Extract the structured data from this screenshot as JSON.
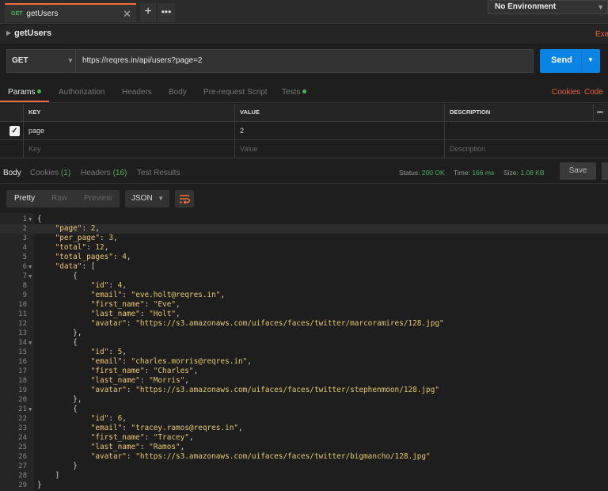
{
  "tab": {
    "method": "GET",
    "name": "getUsers",
    "close": "✕",
    "add": "+",
    "more": "•••"
  },
  "environment": {
    "selected": "No Environment"
  },
  "request": {
    "title": "getUsers",
    "examples_link": "Exa",
    "method": "GET",
    "url": "https://reqres.in/api/users?page=2",
    "send_label": "Send"
  },
  "request_tabs": {
    "params": "Params",
    "authorization": "Authorization",
    "headers": "Headers",
    "body": "Body",
    "prerequest": "Pre-request Script",
    "tests": "Tests",
    "cookies": "Cookies",
    "code": "Code"
  },
  "params_table": {
    "headers": [
      "KEY",
      "VALUE",
      "DESCRIPTION"
    ],
    "more": "•••",
    "rows": [
      {
        "key": "page",
        "value": "2",
        "checked": true
      }
    ],
    "placeholders": {
      "key": "Key",
      "value": "Value",
      "description": "Description"
    }
  },
  "response_tabs": {
    "body": "Body",
    "cookies": "Cookies",
    "cookies_count": "(1)",
    "headers": "Headers",
    "headers_count": "(16)",
    "tests": "Test Results"
  },
  "response_status": {
    "status_label": "Status:",
    "status_value": "200 OK",
    "time_label": "Time:",
    "time_value": "166 ms",
    "size_label": "Size:",
    "size_value": "1.08 KB",
    "save_label": "Save"
  },
  "view_modes": {
    "pretty": "Pretty",
    "raw": "Raw",
    "preview": "Preview",
    "format": "JSON"
  },
  "code_lines": [
    {
      "n": "1",
      "fold": true,
      "t": "{"
    },
    {
      "n": "2",
      "t": "    \"page\": 2,"
    },
    {
      "n": "3",
      "t": "    \"per_page\": 3,"
    },
    {
      "n": "4",
      "t": "    \"total\": 12,"
    },
    {
      "n": "5",
      "t": "    \"total_pages\": 4,"
    },
    {
      "n": "6",
      "fold": true,
      "t": "    \"data\": ["
    },
    {
      "n": "7",
      "fold": true,
      "t": "        {"
    },
    {
      "n": "8",
      "t": "            \"id\": 4,"
    },
    {
      "n": "9",
      "t": "            \"email\": \"eve.holt@reqres.in\","
    },
    {
      "n": "10",
      "t": "            \"first_name\": \"Eve\","
    },
    {
      "n": "11",
      "t": "            \"last_name\": \"Holt\","
    },
    {
      "n": "12",
      "t": "            \"avatar\": \"https://s3.amazonaws.com/uifaces/faces/twitter/marcoramires/128.jpg\""
    },
    {
      "n": "13",
      "t": "        },"
    },
    {
      "n": "14",
      "fold": true,
      "t": "        {"
    },
    {
      "n": "15",
      "t": "            \"id\": 5,"
    },
    {
      "n": "16",
      "t": "            \"email\": \"charles.morris@reqres.in\","
    },
    {
      "n": "17",
      "t": "            \"first_name\": \"Charles\","
    },
    {
      "n": "18",
      "t": "            \"last_name\": \"Morris\","
    },
    {
      "n": "19",
      "t": "            \"avatar\": \"https://s3.amazonaws.com/uifaces/faces/twitter/stephenmoon/128.jpg\""
    },
    {
      "n": "20",
      "t": "        },"
    },
    {
      "n": "21",
      "fold": true,
      "t": "        {"
    },
    {
      "n": "22",
      "t": "            \"id\": 6,"
    },
    {
      "n": "23",
      "t": "            \"email\": \"tracey.ramos@reqres.in\","
    },
    {
      "n": "24",
      "t": "            \"first_name\": \"Tracey\","
    },
    {
      "n": "25",
      "t": "            \"last_name\": \"Ramos\","
    },
    {
      "n": "26",
      "t": "            \"avatar\": \"https://s3.amazonaws.com/uifaces/faces/twitter/bigmancho/128.jpg\""
    },
    {
      "n": "27",
      "t": "        }"
    },
    {
      "n": "28",
      "t": "    ]"
    },
    {
      "n": "29",
      "t": "}"
    }
  ],
  "colors": {
    "accent": "#f26b3a",
    "send": "#0a84e4",
    "success": "#4fae5e"
  }
}
